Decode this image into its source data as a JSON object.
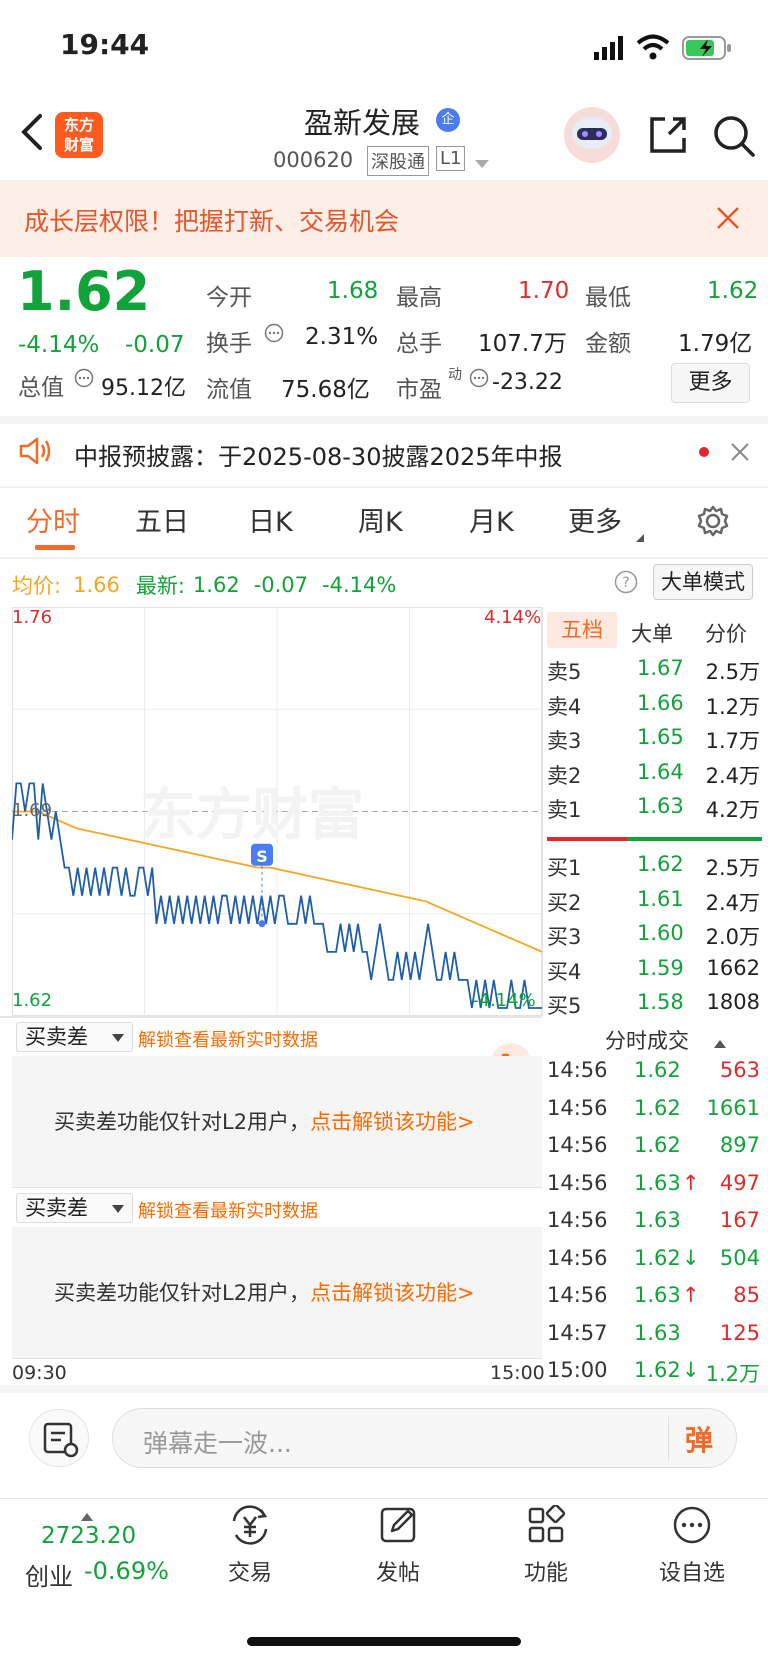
{
  "status_bar": {
    "time": "19:44"
  },
  "header": {
    "stock_name": "盈新发展",
    "enterprise_badge": "企",
    "code": "000620",
    "market_badge": "深股通",
    "level_badge": "L1",
    "app_logo_line1": "东方",
    "app_logo_line2": "财富"
  },
  "banner": {
    "text": "成长层权限！把握打新、交易机会"
  },
  "quote": {
    "price": "1.62",
    "change_pct": "-4.14%",
    "change": "-0.07",
    "open_label": "今开",
    "open": "1.68",
    "high_label": "最高",
    "high": "1.70",
    "low_label": "最低",
    "low": "1.62",
    "turnover_label": "换手",
    "turnover": "2.31%",
    "volume_label": "总手",
    "volume": "107.7万",
    "amount_label": "金额",
    "amount": "1.79亿",
    "mktcap_label": "总值",
    "mktcap": "95.12亿",
    "float_label": "流值",
    "float_cap": "75.68亿",
    "pe_label": "市盈",
    "pe_sup": "动",
    "pe": "-23.22",
    "more_button": "更多"
  },
  "notice": {
    "text": "中报预披露：于2025-08-30披露2025年中报"
  },
  "tabs": [
    {
      "label": "分时"
    },
    {
      "label": "五日"
    },
    {
      "label": "日K"
    },
    {
      "label": "周K"
    },
    {
      "label": "月K"
    },
    {
      "label": "更多"
    }
  ],
  "info_line": {
    "avg_label": "均价:",
    "avg": "1.66",
    "latest_label": "最新:",
    "latest": "1.62",
    "latest_change": "-0.07",
    "latest_pct": "-4.14%",
    "big_order_button": "大单模式"
  },
  "chart_data": {
    "type": "line",
    "title": "",
    "x_start_label": "09:30",
    "x_end_label": "15:00",
    "y_max_label": "1.76",
    "y_min_label": "1.62",
    "y_mid_label": "1.69",
    "pct_max_label": "4.14%",
    "pct_min_label": "-4.14%",
    "ylim": [
      1.62,
      1.76
    ],
    "reference_price": 1.69,
    "watermark": "东方财富",
    "marker_label": "S",
    "series": [
      {
        "name": "",
        "color": "#1f5fa8",
        "values": [
          1.68,
          1.7,
          1.7,
          1.69,
          1.7,
          1.7,
          1.68,
          1.7,
          1.69,
          1.68,
          1.69,
          1.68,
          1.67,
          1.67,
          1.66,
          1.67,
          1.66,
          1.67,
          1.66,
          1.67,
          1.66,
          1.67,
          1.66,
          1.67,
          1.67,
          1.66,
          1.67,
          1.66,
          1.66,
          1.67,
          1.67,
          1.66,
          1.67,
          1.65,
          1.66,
          1.65,
          1.66,
          1.65,
          1.66,
          1.65,
          1.66,
          1.65,
          1.66,
          1.65,
          1.66,
          1.65,
          1.66,
          1.65,
          1.66,
          1.66,
          1.65,
          1.66,
          1.65,
          1.66,
          1.65,
          1.66,
          1.65,
          1.66,
          1.65,
          1.66,
          1.65,
          1.66,
          1.66,
          1.65,
          1.65,
          1.65,
          1.66,
          1.65,
          1.66,
          1.65,
          1.65,
          1.65,
          1.64,
          1.64,
          1.64,
          1.65,
          1.64,
          1.65,
          1.64,
          1.65,
          1.64,
          1.64,
          1.63,
          1.64,
          1.65,
          1.64,
          1.63,
          1.63,
          1.64,
          1.63,
          1.64,
          1.63,
          1.64,
          1.63,
          1.64,
          1.65,
          1.64,
          1.63,
          1.63,
          1.64,
          1.63,
          1.64,
          1.63,
          1.63,
          1.63,
          1.62,
          1.63,
          1.62,
          1.63,
          1.62,
          1.63,
          1.62,
          1.62,
          1.62,
          1.63,
          1.62,
          1.62,
          1.63,
          1.62,
          1.62,
          1.62,
          1.62
        ]
      },
      {
        "name": "",
        "color": "#f5a623",
        "values": [
          1.69,
          1.69,
          1.69,
          1.688,
          1.686,
          1.684,
          1.683,
          1.682,
          1.681,
          1.68,
          1.679,
          1.678,
          1.677,
          1.676,
          1.675,
          1.674,
          1.673,
          1.672,
          1.671,
          1.67,
          1.67,
          1.669,
          1.668,
          1.667,
          1.666,
          1.665,
          1.664,
          1.663,
          1.662,
          1.661,
          1.66,
          1.659,
          1.658,
          1.656,
          1.654,
          1.652,
          1.65,
          1.648,
          1.646,
          1.644,
          1.642,
          1.64
        ]
      }
    ]
  },
  "order_book": {
    "tabs": [
      "五档",
      "大单",
      "分价"
    ],
    "sell": [
      {
        "label": "卖5",
        "price": "1.67",
        "vol": "2.5万"
      },
      {
        "label": "卖4",
        "price": "1.66",
        "vol": "1.2万"
      },
      {
        "label": "卖3",
        "price": "1.65",
        "vol": "1.7万"
      },
      {
        "label": "卖2",
        "price": "1.64",
        "vol": "2.4万"
      },
      {
        "label": "卖1",
        "price": "1.63",
        "vol": "4.2万"
      }
    ],
    "buy": [
      {
        "label": "买1",
        "price": "1.62",
        "vol": "2.5万"
      },
      {
        "label": "买2",
        "price": "1.61",
        "vol": "2.4万"
      },
      {
        "label": "买3",
        "price": "1.60",
        "vol": "2.0万"
      },
      {
        "label": "买4",
        "price": "1.59",
        "vol": "1662"
      },
      {
        "label": "买5",
        "price": "1.58",
        "vol": "1808"
      }
    ]
  },
  "ticks": {
    "title": "分时成交",
    "rows": [
      {
        "time": "14:56",
        "price": "1.62",
        "vol": "563",
        "arrow": "",
        "color": "red"
      },
      {
        "time": "14:56",
        "price": "1.62",
        "vol": "1661",
        "arrow": "",
        "color": "green"
      },
      {
        "time": "14:56",
        "price": "1.62",
        "vol": "897",
        "arrow": "",
        "color": "green"
      },
      {
        "time": "14:56",
        "price": "1.63",
        "vol": "497",
        "arrow": "↑",
        "color": "red"
      },
      {
        "time": "14:56",
        "price": "1.63",
        "vol": "167",
        "arrow": "",
        "color": "red"
      },
      {
        "time": "14:56",
        "price": "1.62",
        "vol": "504",
        "arrow": "↓",
        "color": "green"
      },
      {
        "time": "14:56",
        "price": "1.63",
        "vol": "85",
        "arrow": "↑",
        "color": "red"
      },
      {
        "time": "14:57",
        "price": "1.63",
        "vol": "125",
        "arrow": "",
        "color": "red"
      },
      {
        "time": "15:00",
        "price": "1.62",
        "vol": "1.2万",
        "arrow": "↓",
        "color": "green"
      }
    ]
  },
  "panels": [
    {
      "select": "买卖差",
      "unlock_link": "解锁查看最新实时数据",
      "msg": "买卖差功能仅针对L2用户，",
      "cta": "点击解锁该功能>"
    },
    {
      "select": "买卖差",
      "unlock_link": "解锁查看最新实时数据",
      "msg": "买卖差功能仅针对L2用户，",
      "cta": "点击解锁该功能>"
    }
  ],
  "comment": {
    "placeholder": "弹幕走一波...",
    "danmu_label": "弹"
  },
  "bottom_nav": {
    "index_value": "2723.20",
    "index_name": "创业",
    "index_pct": "-0.69%",
    "items": [
      {
        "label": "交易"
      },
      {
        "label": "发帖"
      },
      {
        "label": "功能"
      },
      {
        "label": "设自选"
      }
    ]
  }
}
